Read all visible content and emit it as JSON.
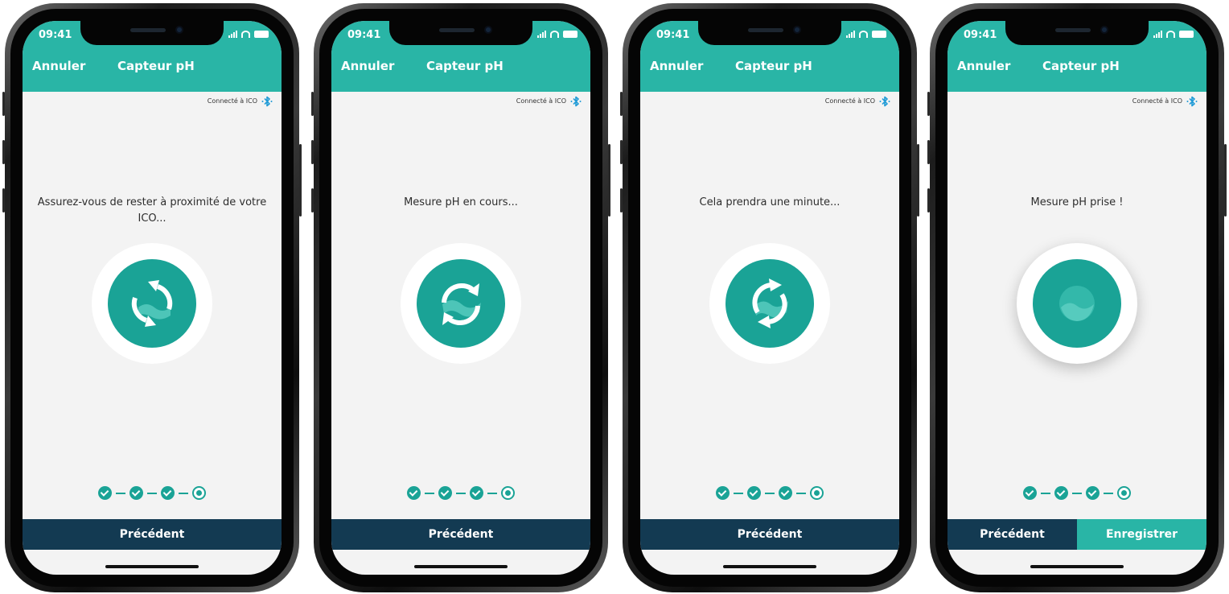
{
  "colors": {
    "teal": "#29b5a6",
    "navy": "#133a52",
    "bluetooth": "#1e9ad6"
  },
  "screens": [
    {
      "status_time": "09:41",
      "nav_cancel": "Annuler",
      "nav_title": "Capteur pH",
      "connection": "Connecté à ICO",
      "message": "Assurez-vous de rester à proximité de votre ICO...",
      "icon": "sync-icon",
      "steps_done": 3,
      "prev_label": "Précédent"
    },
    {
      "status_time": "09:41",
      "nav_cancel": "Annuler",
      "nav_title": "Capteur pH",
      "connection": "Connecté à ICO",
      "message": "Mesure pH en cours...",
      "icon": "sync-icon",
      "steps_done": 3,
      "prev_label": "Précédent"
    },
    {
      "status_time": "09:41",
      "nav_cancel": "Annuler",
      "nav_title": "Capteur pH",
      "connection": "Connecté à ICO",
      "message": "Cela prendra une minute...",
      "icon": "sync-icon",
      "steps_done": 3,
      "prev_label": "Précédent"
    },
    {
      "status_time": "09:41",
      "nav_cancel": "Annuler",
      "nav_title": "Capteur pH",
      "connection": "Connecté à ICO",
      "message": "Mesure pH prise !",
      "icon": "water-drop-icon",
      "steps_done": 3,
      "prev_label": "Précédent",
      "save_label": "Enregistrer"
    }
  ]
}
